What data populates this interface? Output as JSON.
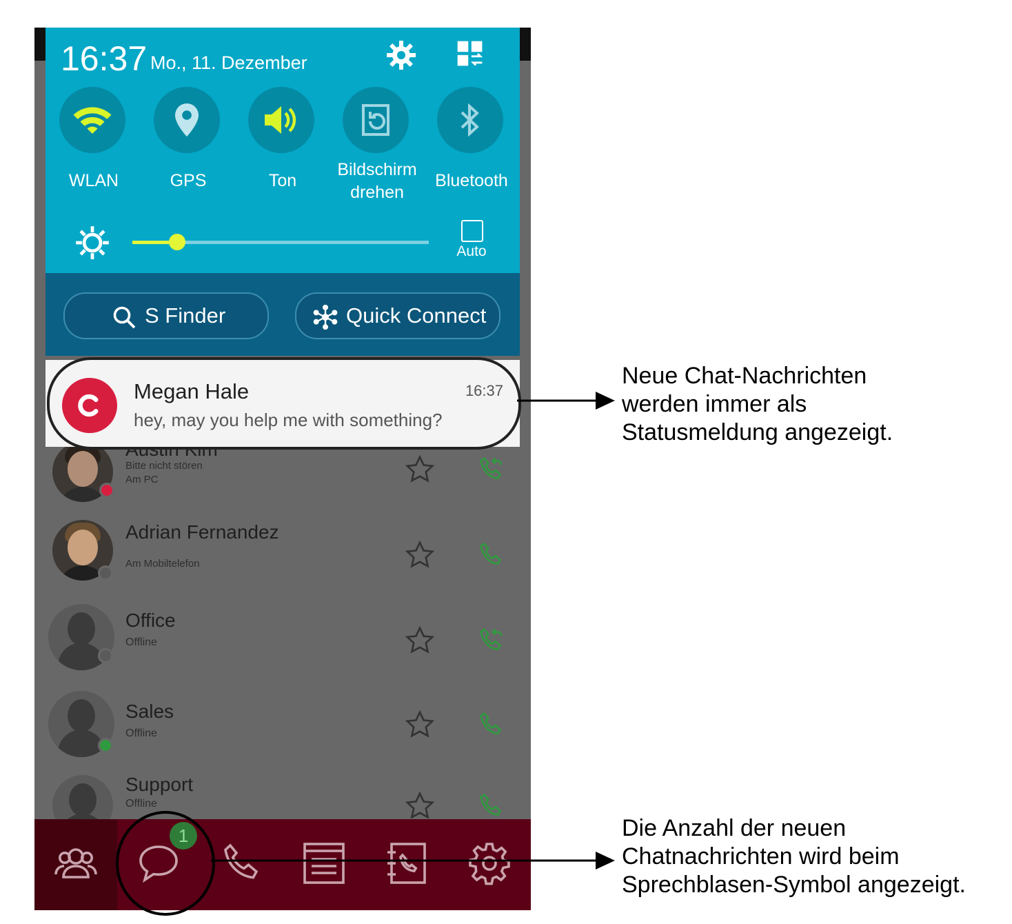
{
  "status_panel": {
    "time": "16:37",
    "date": "Mo., 11. Dezember",
    "toggles": [
      {
        "label": "WLAN",
        "icon": "wifi-icon",
        "active": true
      },
      {
        "label": "GPS",
        "icon": "location-pin-icon",
        "active": false
      },
      {
        "label": "Ton",
        "icon": "speaker-icon",
        "active": true
      },
      {
        "label": "Bildschirm drehen",
        "line1": "Bildschirm",
        "line2": "drehen",
        "icon": "rotate-screen-icon",
        "active": false
      },
      {
        "label": "Bluetooth",
        "icon": "bluetooth-icon",
        "active": false
      }
    ],
    "brightness": {
      "level": 0.15,
      "auto_label": "Auto",
      "auto_checked": false
    },
    "buttons": {
      "finder": "S Finder",
      "quick_connect": "Quick Connect"
    }
  },
  "notification": {
    "sender": "Megan Hale",
    "time": "16:37",
    "message": "hey, may you help me with something?",
    "app_icon": "app-logo-icon"
  },
  "contacts": [
    {
      "name": "Austin Kim",
      "status_text": "Bitte nicht stören",
      "location": "Am PC",
      "status_color": "#d81e3f"
    },
    {
      "name": "Adrian Fernandez",
      "status_text": "",
      "location": "Am Mobiltelefon",
      "status_color": "#5a5a5a"
    },
    {
      "name": "Office",
      "status_text": "Offline",
      "location": "",
      "status_color": "#5a5a5a"
    },
    {
      "name": "Sales",
      "status_text": "Offline",
      "location": "",
      "status_color": "#2f9a3f"
    },
    {
      "name": "Support",
      "status_text": "Offline",
      "location": "",
      "status_color": "#5a5a5a"
    }
  ],
  "bottom_nav": {
    "items": [
      "contacts-icon",
      "chat-bubble-icon",
      "phone-icon",
      "history-icon",
      "address-book-icon",
      "settings-icon"
    ],
    "chat_badge": "1",
    "active_item": "contacts-icon"
  },
  "annotations": {
    "note1": [
      "Neue Chat-Nachrichten",
      "werden immer als",
      "Statusmeldung angezeigt."
    ],
    "note2": [
      "Die Anzahl der neuen",
      "Chatnachrichten wird beim",
      "Sprechblasen-Symbol angezeigt."
    ]
  },
  "colors": {
    "panel": "#05a8c7",
    "finder_bar": "#0a6185",
    "nav_bar": "#5b0016",
    "accent_yellow": "#e3f536",
    "call_green": "#2f9a3f",
    "app_red": "#d81e3f"
  }
}
